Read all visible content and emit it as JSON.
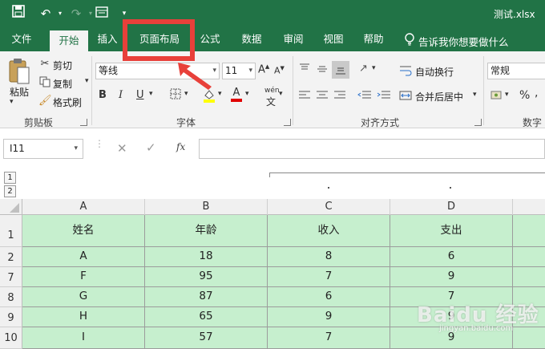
{
  "titlebar": {
    "filename": "测试.xlsx"
  },
  "tabs": [
    "文件",
    "开始",
    "插入",
    "页面布局",
    "公式",
    "数据",
    "审阅",
    "视图",
    "帮助"
  ],
  "tell_me": "告诉我你想要做什么",
  "clipboard": {
    "paste": "粘贴",
    "cut": "剪切",
    "copy": "复制",
    "format_painter": "格式刷",
    "group_label": "剪贴板"
  },
  "font": {
    "name": "等线",
    "size": "11",
    "bold": "B",
    "italic": "I",
    "underline": "U",
    "font_color": "A",
    "phonetic": "wén",
    "group_label": "字体"
  },
  "alignment": {
    "wrap_text": "自动换行",
    "merge_center": "合并后居中",
    "group_label": "对齐方式"
  },
  "number": {
    "format": "常规",
    "percent": "%",
    "group_label": "数字"
  },
  "formula_bar": {
    "cell_ref": "I11",
    "fx": "fx"
  },
  "outline_levels": [
    "1",
    "2"
  ],
  "columns": [
    "A",
    "B",
    "C",
    "D"
  ],
  "table": {
    "rows": [
      {
        "row": "1",
        "cells": [
          "姓名",
          "年龄",
          "收入",
          "支出"
        ]
      },
      {
        "row": "2",
        "cells": [
          "A",
          "18",
          "8",
          "6"
        ]
      },
      {
        "row": "7",
        "cells": [
          "F",
          "95",
          "7",
          "9"
        ]
      },
      {
        "row": "8",
        "cells": [
          "G",
          "87",
          "6",
          "7"
        ]
      },
      {
        "row": "9",
        "cells": [
          "H",
          "65",
          "9",
          "9"
        ]
      },
      {
        "row": "10",
        "cells": [
          "I",
          "57",
          "7",
          "9"
        ]
      }
    ]
  },
  "watermark": {
    "brand": "Baidu 经验",
    "url": "jingyan.baidu.com"
  },
  "colors": {
    "excel_green": "#217346",
    "cell_fill": "#c6efce",
    "annotation_red": "#e8403a"
  }
}
